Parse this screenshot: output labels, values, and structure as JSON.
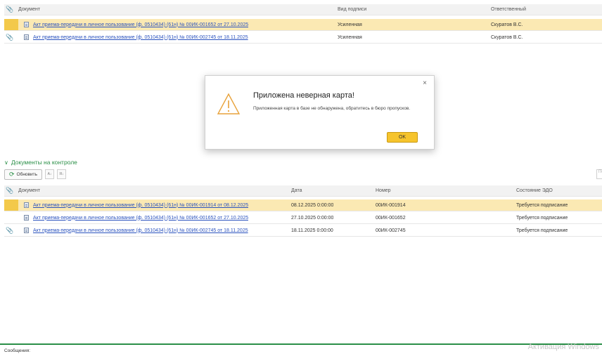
{
  "top_grid": {
    "headers": {
      "document": "Документ",
      "signature_type": "Вид подписи",
      "responsible": "Ответственный"
    },
    "rows": [
      {
        "document": "Акт приема-передачи в личное пользование (ф. 0510434) (61н) № 00ИК-001652 от 27.10.2025",
        "signature_type": "Усиленная",
        "responsible": "Скуратов В.С."
      },
      {
        "document": "Акт приема-передачи в личное пользование (ф. 0510434) (61н) № 00ИК-002745 от 18.11.2025",
        "signature_type": "Усиленная",
        "responsible": "Скуратов В.С."
      }
    ]
  },
  "dialog": {
    "title": "Приложена неверная карта!",
    "message": "Приложенная карта в базе не обнаружена, обратитесь в бюро пропусков.",
    "ok_label": "OK",
    "close_glyph": "×"
  },
  "control_section": {
    "title": "Документы на контроле",
    "refresh_label": "Обновить",
    "search_placeholder": "По"
  },
  "bottom_grid": {
    "headers": {
      "document": "Документ",
      "date": "Дата",
      "number": "Номер",
      "edo_status": "Состояние ЭДО"
    },
    "rows": [
      {
        "document": "Акт приема-передачи в личное пользование (ф. 0510434) (61н) № 00ИК-001914 от 08.12.2025",
        "date": "08.12.2025 0:00:00",
        "number": "00ИК-001914",
        "edo_status": "Требуется подписание"
      },
      {
        "document": "Акт приема-передачи в личное пользование (ф. 0510434) (61н) № 00ИК-001652 от 27.10.2025",
        "date": "27.10.2025 0:00:00",
        "number": "00ИК-001652",
        "edo_status": "Требуется подписание"
      },
      {
        "document": "Акт приема-передачи в личное пользование (ф. 0510434) (61н) № 00ИК-002745 от 18.11.2025",
        "date": "18.11.2025 0:00:00",
        "number": "00ИК-002745",
        "edo_status": "Требуется подписание"
      }
    ]
  },
  "footer": {
    "messages_label": "Сообщения:",
    "watermark": "Активация Windows"
  },
  "colors": {
    "accent_green": "#2a8f47",
    "selection": "#fbe9b3",
    "ok_button": "#f6c42d",
    "link": "#2a52be"
  }
}
